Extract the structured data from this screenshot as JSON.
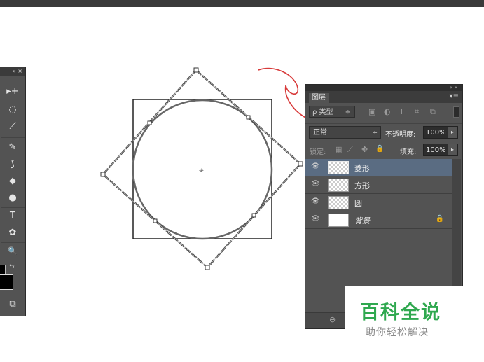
{
  "colors": {
    "panel_bg": "#535353",
    "selected_row": "#5a6c82",
    "watermark_green": "#2fa84f",
    "annotation_red": "#d83a3a"
  },
  "tools_panel": {
    "collapse_glyphs": "«  ×",
    "tools": [
      {
        "name": "move-tool-icon",
        "glyph": "▸+"
      },
      {
        "name": "quick-select-icon",
        "glyph": "◌"
      },
      {
        "name": "eyedropper-icon",
        "glyph": "⟋"
      },
      {
        "name": "brush-icon",
        "glyph": "✎"
      },
      {
        "name": "history-brush-icon",
        "glyph": "⟆"
      },
      {
        "name": "paint-bucket-icon",
        "glyph": "◆"
      },
      {
        "name": "dodge-icon",
        "glyph": "●"
      },
      {
        "name": "type-tool-icon",
        "glyph": "T"
      },
      {
        "name": "custom-shape-icon",
        "glyph": "✿"
      },
      {
        "name": "zoom-icon",
        "glyph": "🔍"
      },
      {
        "name": "screen-mode-icon",
        "glyph": "⧉"
      }
    ],
    "swap_glyph": "⇆"
  },
  "layers_panel": {
    "strip_glyphs": "«  ×",
    "tab_label": "图层",
    "menu_glyph": "▾≡",
    "filter": {
      "kind_label": "ρ 类型",
      "kind_arrow": "÷",
      "icons": [
        "▣",
        "◐",
        "T",
        "⌗",
        "⧉"
      ]
    },
    "blend_mode": "正常",
    "blend_arrow": "÷",
    "opacity_label": "不透明度:",
    "opacity_value": "100%",
    "lock_label": "锁定:",
    "lock_icons": [
      "▦",
      "⟋",
      "✥",
      "🔒"
    ],
    "fill_label": "填充:",
    "fill_value": "100%",
    "stepper_glyph": "▸",
    "layers": [
      {
        "name": "菱形",
        "selected": true,
        "thumb": "transparent",
        "eye": "👁"
      },
      {
        "name": "方形",
        "selected": false,
        "thumb": "transparent",
        "eye": "👁"
      },
      {
        "name": "圆",
        "selected": false,
        "thumb": "transparent",
        "eye": "👁"
      },
      {
        "name": "背景",
        "selected": false,
        "thumb": "white",
        "eye": "👁",
        "locked": true,
        "lock_glyph": "🔒"
      }
    ],
    "link_glyph": "⊖"
  },
  "watermark": {
    "title": "百科全说",
    "subtitle": "助你轻松解决"
  },
  "canvas": {
    "center_glyph": "⌖"
  }
}
